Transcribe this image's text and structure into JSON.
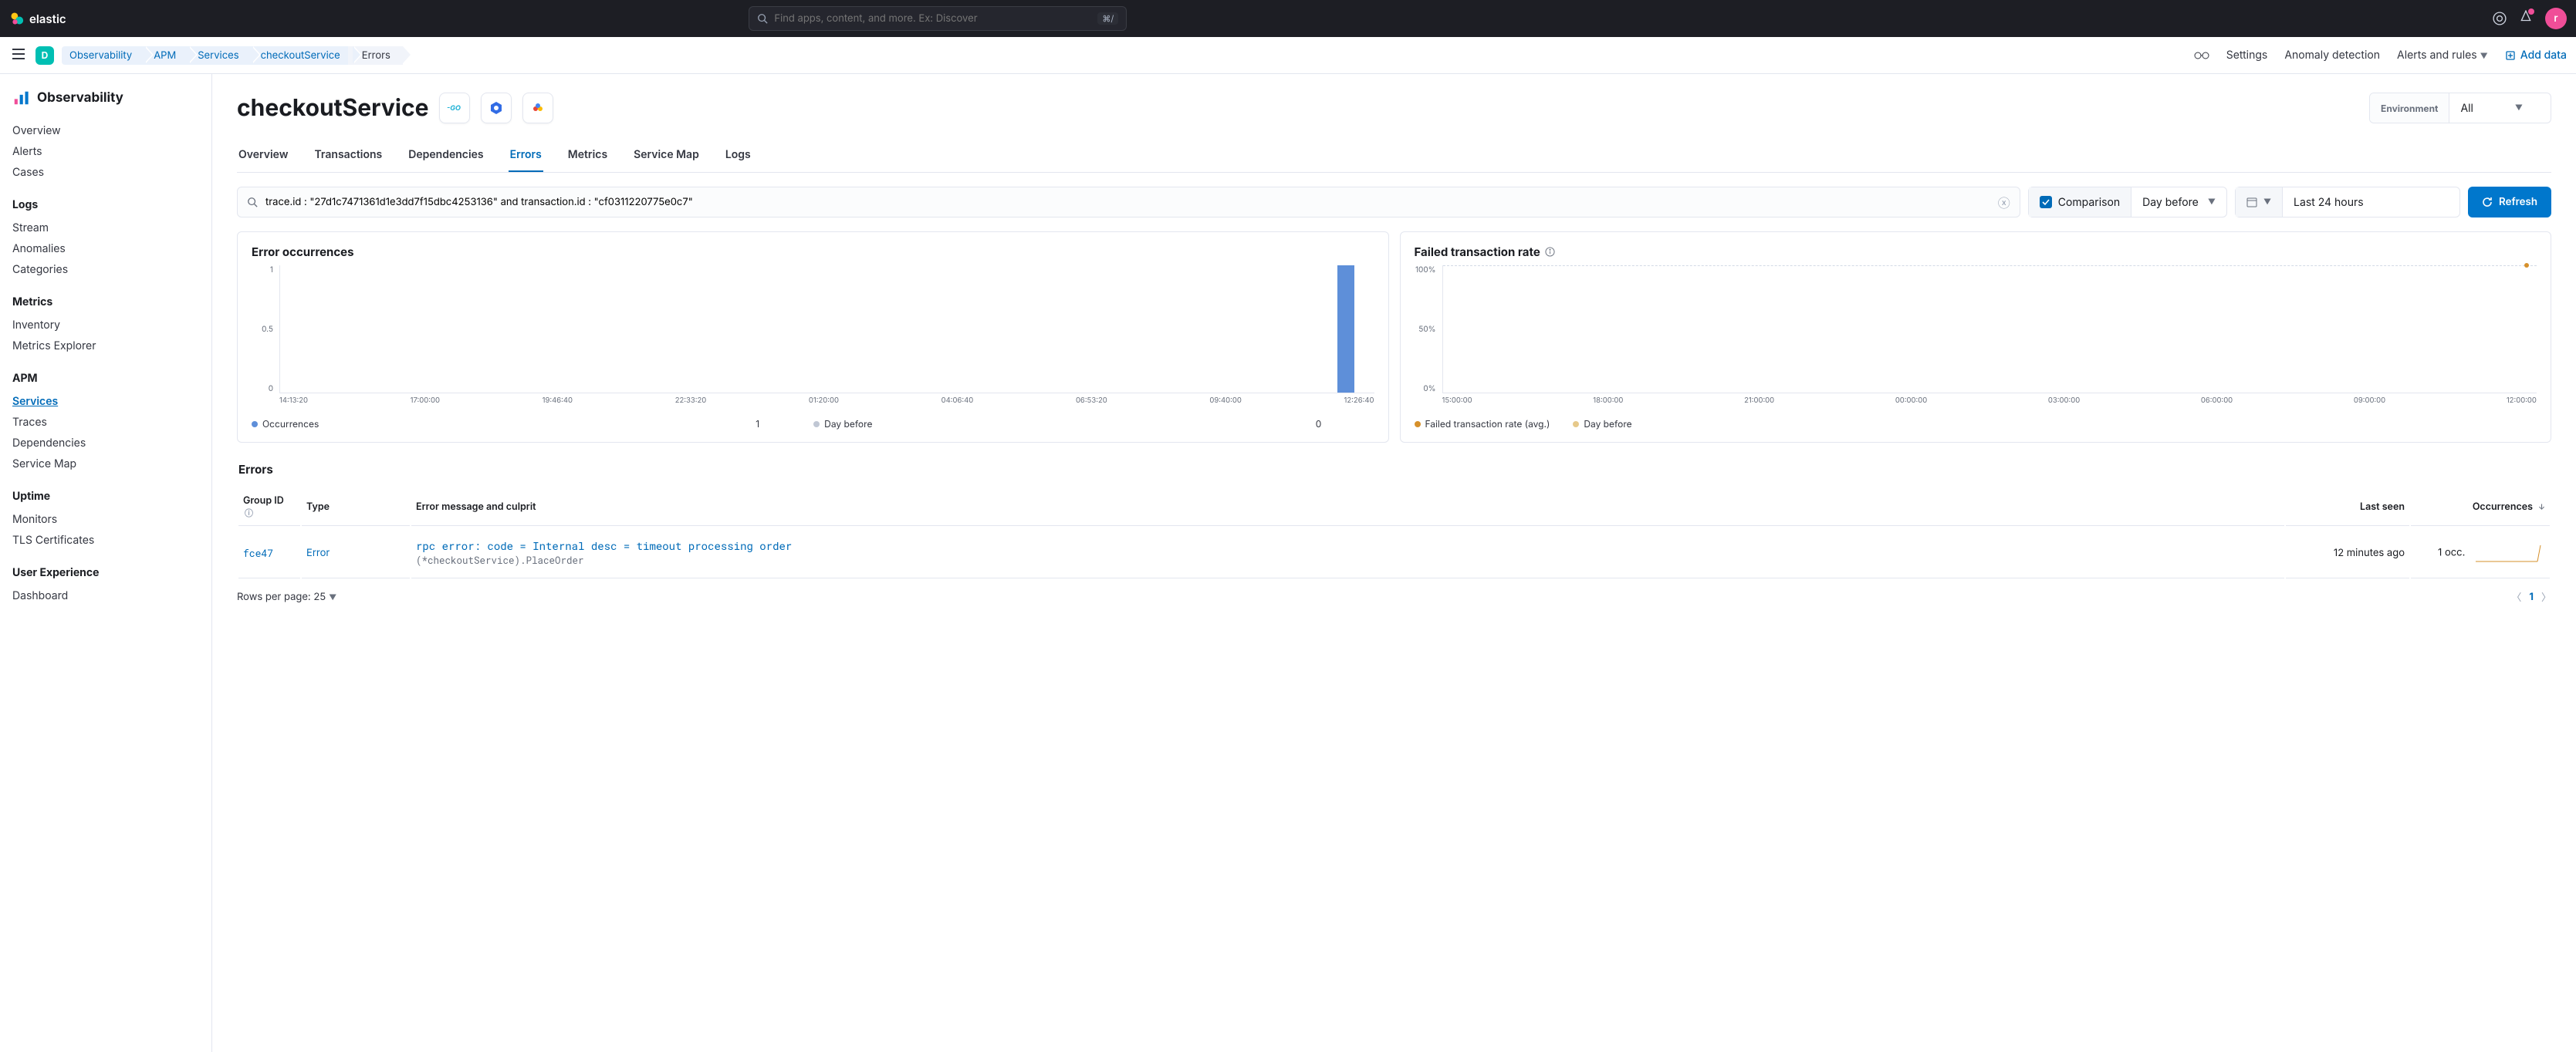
{
  "header": {
    "brand": "elastic",
    "search_placeholder": "Find apps, content, and more. Ex: Discover",
    "search_kbd": "⌘/",
    "avatar_initial": "r",
    "space_initial": "D"
  },
  "breadcrumbs": [
    "Observability",
    "APM",
    "Services",
    "checkoutService",
    "Errors"
  ],
  "subbar_actions": {
    "settings": "Settings",
    "anomaly": "Anomaly detection",
    "alerts": "Alerts and rules",
    "add_data": "Add data"
  },
  "sidebar": {
    "title": "Observability",
    "groups": [
      {
        "head": null,
        "items": [
          "Overview",
          "Alerts",
          "Cases"
        ]
      },
      {
        "head": "Logs",
        "items": [
          "Stream",
          "Anomalies",
          "Categories"
        ]
      },
      {
        "head": "Metrics",
        "items": [
          "Inventory",
          "Metrics Explorer"
        ]
      },
      {
        "head": "APM",
        "items": [
          "Services",
          "Traces",
          "Dependencies",
          "Service Map"
        ],
        "active": "Services"
      },
      {
        "head": "Uptime",
        "items": [
          "Monitors",
          "TLS Certificates"
        ]
      },
      {
        "head": "User Experience",
        "items": [
          "Dashboard"
        ]
      }
    ]
  },
  "page": {
    "title": "checkoutService",
    "env_label": "Environment",
    "env_value": "All",
    "tabs": [
      "Overview",
      "Transactions",
      "Dependencies",
      "Errors",
      "Metrics",
      "Service Map",
      "Logs"
    ],
    "active_tab": "Errors"
  },
  "filters": {
    "query": "trace.id : \"27d1c7471361d1e3dd7f15dbc4253136\" and transaction.id : \"cf0311220775e0c7\"",
    "comparison_label": "Comparison",
    "comparison_option": "Day before",
    "timerange": "Last 24 hours",
    "refresh": "Refresh"
  },
  "charts": {
    "occ": {
      "title": "Error occurrences",
      "y_ticks": [
        "1",
        "0.5",
        "0"
      ],
      "x_ticks": [
        "14:13:20",
        "17:00:00",
        "19:46:40",
        "22:33:20",
        "01:20:00",
        "04:06:40",
        "06:53:20",
        "09:40:00",
        "12:26:40"
      ],
      "legend": [
        {
          "label": "Occurrences",
          "value": "1",
          "color": "#5e8fd9"
        },
        {
          "label": "Day before",
          "value": "0",
          "color": "#c0c7d4"
        }
      ]
    },
    "fail": {
      "title": "Failed transaction rate",
      "y_ticks": [
        "100%",
        "50%",
        "0%"
      ],
      "x_ticks": [
        "15:00:00",
        "18:00:00",
        "21:00:00",
        "00:00:00",
        "03:00:00",
        "06:00:00",
        "09:00:00",
        "12:00:00"
      ],
      "legend": [
        {
          "label": "Failed transaction rate (avg.)",
          "color": "#d6902b"
        },
        {
          "label": "Day before",
          "color": "#e6c98a"
        }
      ]
    }
  },
  "chart_data": [
    {
      "type": "bar",
      "title": "Error occurrences",
      "categories": [
        "14:13:20",
        "17:00:00",
        "19:46:40",
        "22:33:20",
        "01:20:00",
        "04:06:40",
        "06:53:20",
        "09:40:00",
        "12:26:40"
      ],
      "series": [
        {
          "name": "Occurrences",
          "values": [
            0,
            0,
            0,
            0,
            0,
            0,
            0,
            0,
            1
          ]
        },
        {
          "name": "Day before",
          "values": [
            0,
            0,
            0,
            0,
            0,
            0,
            0,
            0,
            0
          ]
        }
      ],
      "ylim": [
        0,
        1
      ]
    },
    {
      "type": "scatter",
      "title": "Failed transaction rate",
      "x": [
        "15:00:00",
        "18:00:00",
        "21:00:00",
        "00:00:00",
        "03:00:00",
        "06:00:00",
        "09:00:00",
        "12:00:00"
      ],
      "series": [
        {
          "name": "Failed transaction rate (avg.)",
          "values": [
            null,
            null,
            null,
            null,
            null,
            null,
            null,
            100
          ]
        },
        {
          "name": "Day before",
          "values": [
            null,
            null,
            null,
            null,
            null,
            null,
            null,
            null
          ]
        }
      ],
      "ylabel": "%",
      "ylim": [
        0,
        100
      ]
    }
  ],
  "errors_table": {
    "title": "Errors",
    "columns": {
      "group": "Group ID",
      "type": "Type",
      "msg": "Error message and culprit",
      "last": "Last seen",
      "occ": "Occurrences"
    },
    "rows": [
      {
        "group": "fce47",
        "type": "Error",
        "message": "rpc error: code = Internal desc = timeout processing order",
        "culprit": "(*checkoutService).PlaceOrder",
        "last_seen": "12 minutes ago",
        "occurrences": "1 occ."
      }
    ],
    "rows_per_page_label": "Rows per page: 25",
    "page_current": "1"
  }
}
